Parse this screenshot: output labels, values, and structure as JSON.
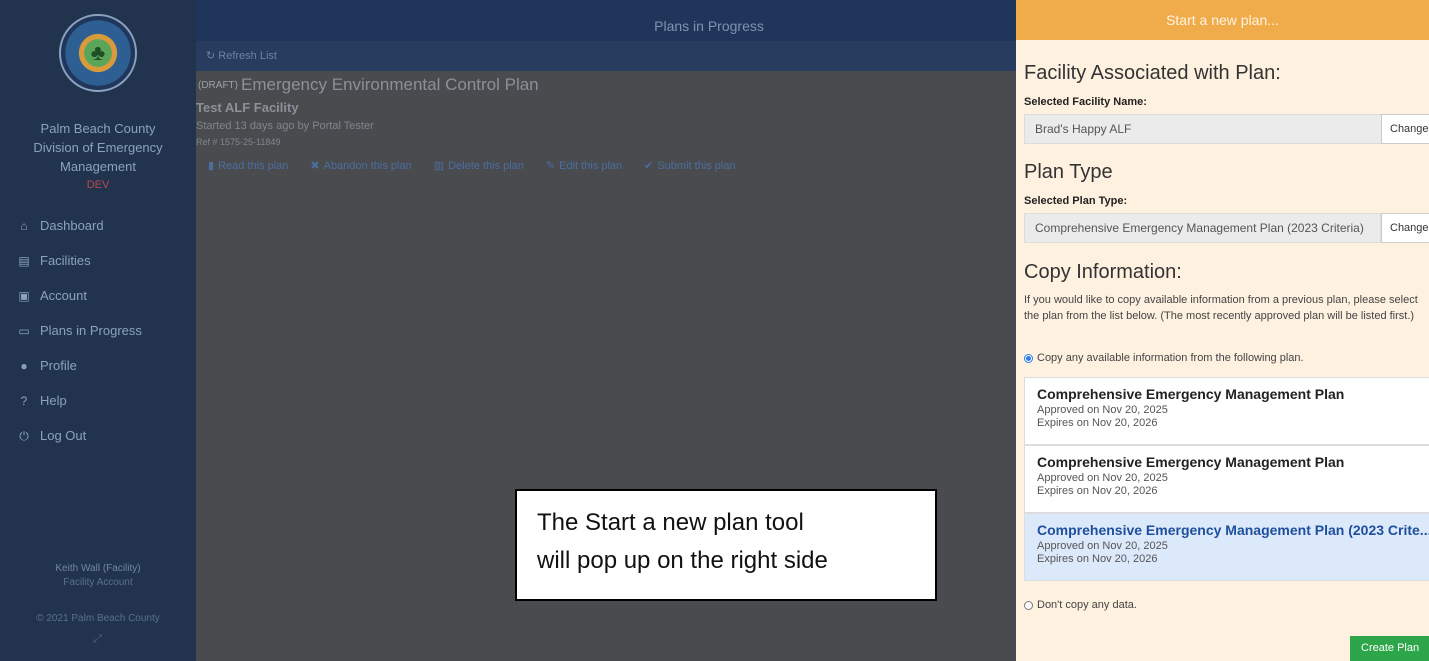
{
  "sidebar": {
    "org_name": "Palm Beach County\nDivision of Emergency\nManagement",
    "env_badge": "DEV",
    "items": [
      {
        "label": "Dashboard",
        "icon": "home-icon"
      },
      {
        "label": "Facilities",
        "icon": "building-icon"
      },
      {
        "label": "Account",
        "icon": "card-icon"
      },
      {
        "label": "Plans in Progress",
        "icon": "inbox-icon"
      },
      {
        "label": "Profile",
        "icon": "user-icon"
      },
      {
        "label": "Help",
        "icon": "question-icon"
      },
      {
        "label": "Log Out",
        "icon": "power-icon"
      }
    ],
    "user_name": "Keith Wall (Facility)",
    "user_role": "Facility Account",
    "copyright": "© 2021 Palm Beach County"
  },
  "main": {
    "title": "Plans in Progress",
    "refresh_label": "Refresh List",
    "plan": {
      "status": "(DRAFT)",
      "title": "Emergency Environmental Control Plan",
      "facility": "Test ALF Facility",
      "started": "Started 13 days ago by Portal Tester",
      "ref": "Ref # 1575-25-11849",
      "actions": [
        {
          "label": "Read this plan",
          "icon": "book-icon"
        },
        {
          "label": "Abandon this plan",
          "icon": "x-icon"
        },
        {
          "label": "Delete this plan",
          "icon": "trash-icon"
        },
        {
          "label": "Edit this plan",
          "icon": "pencil-icon"
        },
        {
          "label": "Submit this plan",
          "icon": "check-icon"
        }
      ]
    }
  },
  "callout": {
    "text": "The Start a new plan tool\nwill pop up on the right side"
  },
  "panel": {
    "header": "Start a new plan...",
    "facility_heading": "Facility Associated with Plan:",
    "facility_label": "Selected Facility Name:",
    "facility_value": "Brad's Happy ALF",
    "change_label": "Change",
    "plan_type_heading": "Plan Type",
    "plan_type_label": "Selected Plan Type:",
    "plan_type_value": "Comprehensive Emergency Management Plan (2023 Criteria)",
    "copy_heading": "Copy Information:",
    "copy_desc": "If you would like to copy available information from a previous plan, please select the plan from the list below. (The most recently approved plan will be listed first.)",
    "copy_option": "Copy any available information from the following plan.",
    "plans": [
      {
        "title": "Comprehensive Emergency Management Plan",
        "approved": "Approved on Nov 20, 2025",
        "expires": "Expires on Nov 20, 2026"
      },
      {
        "title": "Comprehensive Emergency Management Plan",
        "approved": "Approved on Nov 20, 2025",
        "expires": "Expires on Nov 20, 2026"
      },
      {
        "title": "Comprehensive Emergency Management Plan (2023 Crite...",
        "approved": "Approved on Nov 20, 2025",
        "expires": "Expires on Nov 20, 2026"
      }
    ],
    "no_copy_option": "Don't copy any data.",
    "create_label": "Create Plan"
  }
}
